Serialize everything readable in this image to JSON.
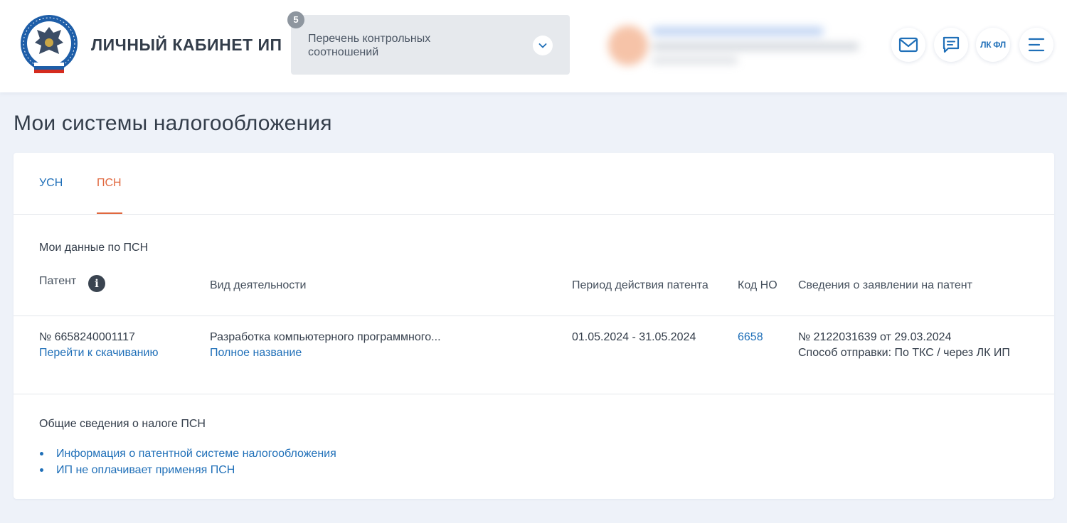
{
  "header": {
    "app_title": "ЛИЧНЫЙ КАБИНЕТ ИП",
    "logo_icon": "fns-emblem-icon",
    "control": {
      "count": "5",
      "label": "Перечень контрольных соотношений"
    },
    "buttons": {
      "lk_fl": "ЛК ФЛ"
    }
  },
  "page": {
    "title": "Мои системы налогообложения"
  },
  "tabs": [
    {
      "label": "УСН",
      "active": false
    },
    {
      "label": "ПСН",
      "active": true
    }
  ],
  "psn": {
    "section_title": "Мои данные по ПСН",
    "columns": [
      "Патент",
      "Вид деятельности",
      "Период действия патента",
      "Код НО",
      "Сведения о заявлении на патент"
    ],
    "row": {
      "patent_number": "№ 6658240001117",
      "download_link": "Перейти к скачиванию",
      "activity": "Разработка компьютерного программного...",
      "full_name_link": "Полное название",
      "period": "01.05.2024 - 31.05.2024",
      "code_no": "6658",
      "application": "№ 2122031639 от 29.03.2024",
      "send_method": "Способ отправки: По ТКС / через ЛК ИП"
    }
  },
  "general": {
    "title": "Общие сведения о налоге ПСН",
    "links": [
      "Информация о патентной системе налогообложения",
      "ИП не оплачивает применяя ПСН"
    ]
  },
  "colors": {
    "accent": "#1f6fb8",
    "active_tab": "#e0683f",
    "background": "#eef2f9"
  }
}
